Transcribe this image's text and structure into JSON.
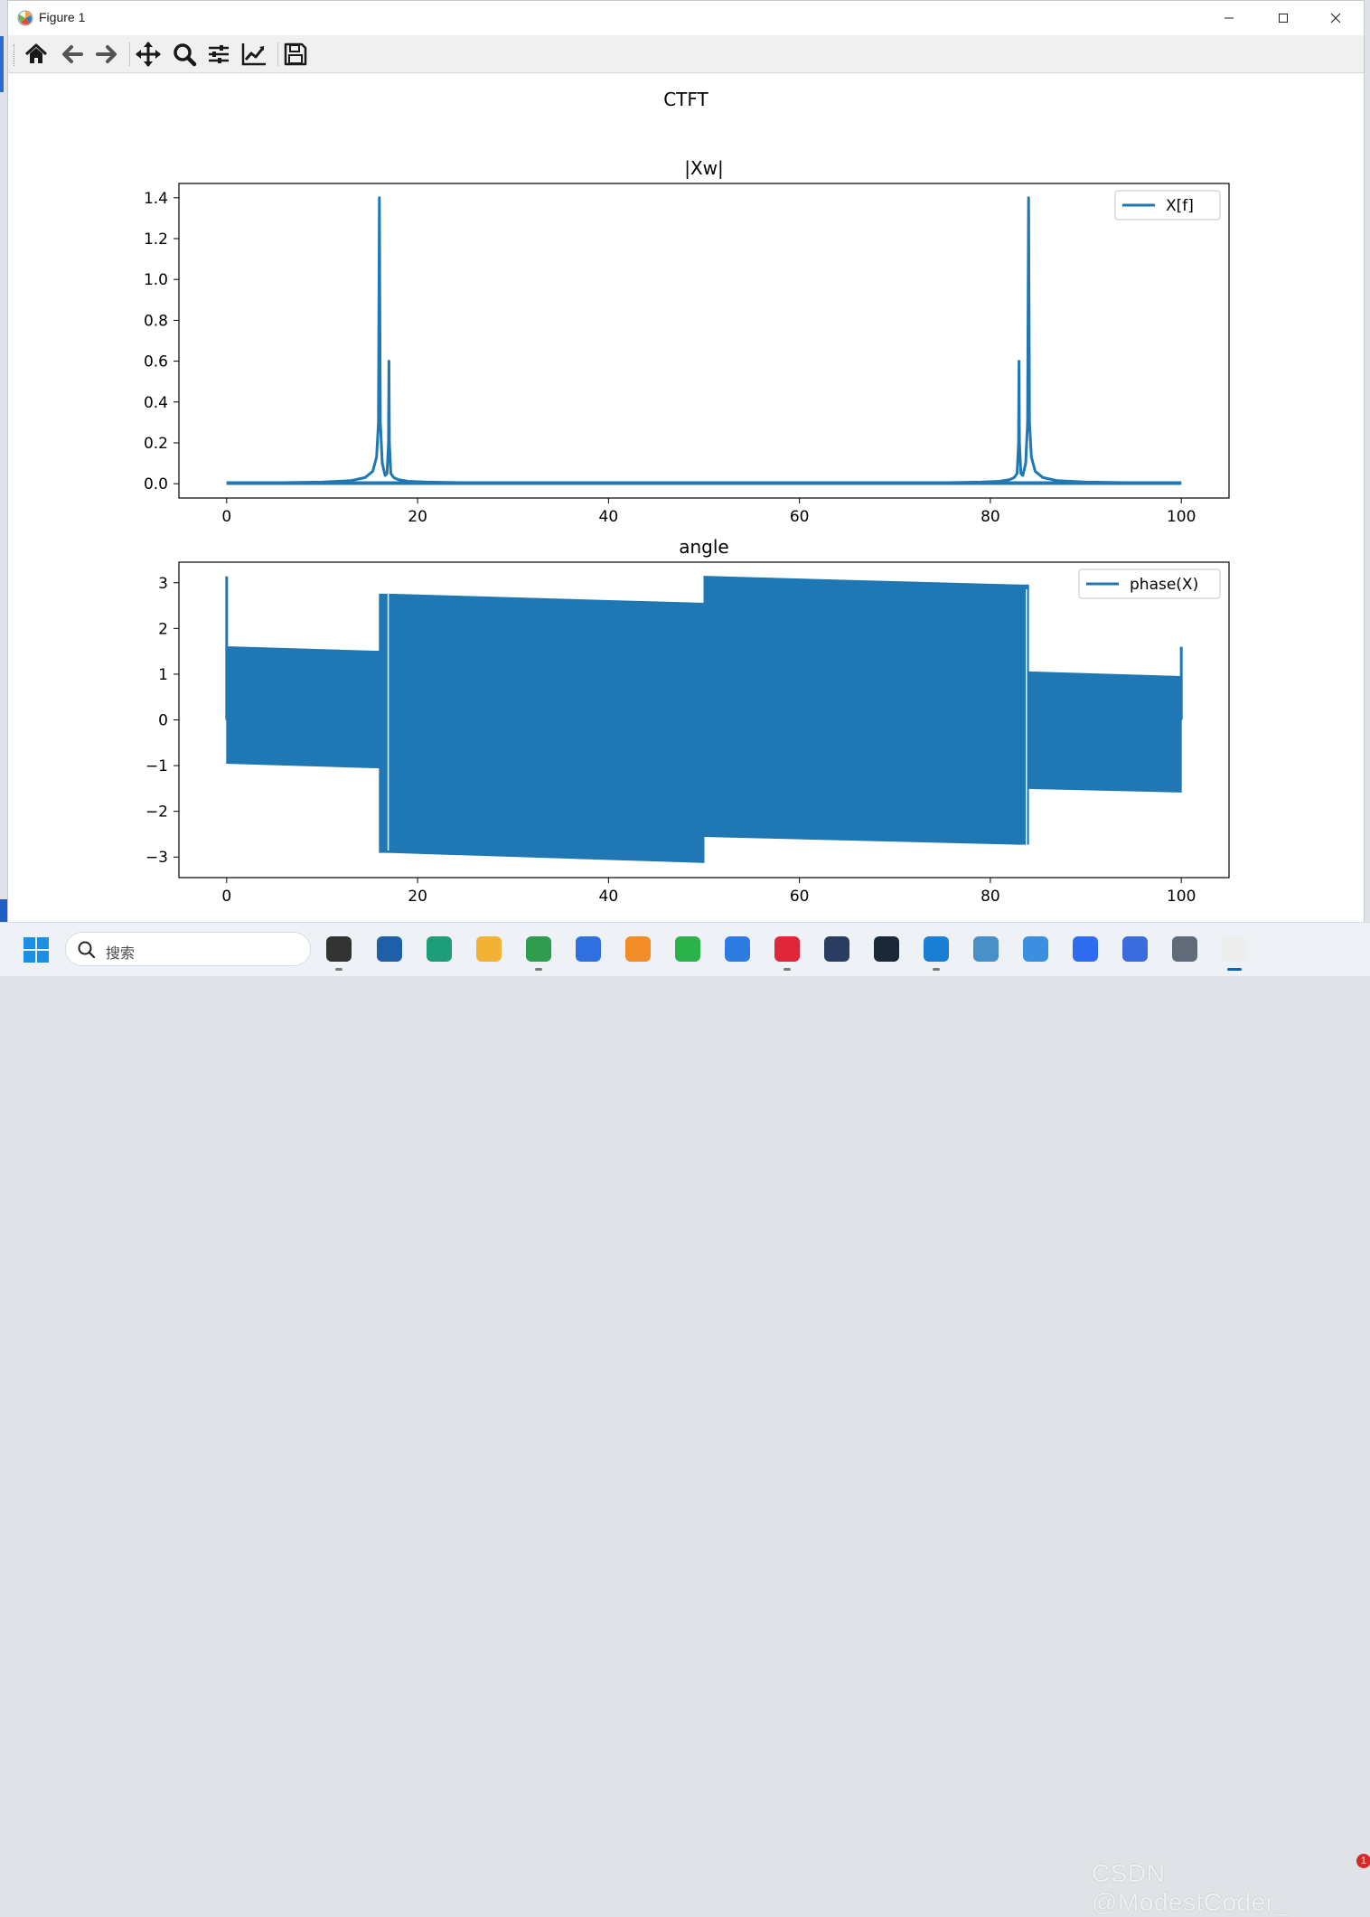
{
  "window": {
    "title": "Figure 1"
  },
  "toolbar": {
    "buttons": [
      {
        "name": "home-icon",
        "label": "Home"
      },
      {
        "name": "back-arrow-icon",
        "label": "Back"
      },
      {
        "name": "forward-arrow-icon",
        "label": "Forward"
      },
      {
        "name": "pan-icon",
        "label": "Pan"
      },
      {
        "name": "zoom-icon",
        "label": "Zoom"
      },
      {
        "name": "configure-subplots-icon",
        "label": "Subplots"
      },
      {
        "name": "edit-axis-icon",
        "label": "Customize"
      },
      {
        "name": "save-icon",
        "label": "Save"
      }
    ]
  },
  "figure": {
    "suptitle": "CTFT"
  },
  "chart_data": [
    {
      "type": "line",
      "title": "|Xw|",
      "xlabel": "",
      "ylabel": "",
      "xlim": [
        -5,
        105
      ],
      "ylim": [
        -0.07,
        1.47
      ],
      "xticks": [
        "0",
        "20",
        "40",
        "60",
        "80",
        "100"
      ],
      "yticks": [
        "0.0",
        "0.2",
        "0.4",
        "0.6",
        "0.8",
        "1.0",
        "1.2",
        "1.4"
      ],
      "legend": {
        "position": "top-right",
        "entries": [
          "X[f]"
        ]
      },
      "color": "#1f77b4",
      "series": [
        {
          "name": "X[f]",
          "x": [
            0,
            5,
            10,
            13,
            14.5,
            15.3,
            15.7,
            15.9,
            16.0,
            16.1,
            16.3,
            16.6,
            16.8,
            16.95,
            17.0,
            17.05,
            17.2,
            17.5,
            18,
            19,
            21,
            25,
            30,
            40,
            50,
            60,
            70,
            75,
            79,
            81,
            82,
            82.5,
            82.8,
            82.95,
            83.0,
            83.05,
            83.2,
            83.4,
            83.7,
            83.9,
            84.0,
            84.1,
            84.3,
            84.7,
            85.5,
            87,
            90,
            95,
            100
          ],
          "y": [
            0.003,
            0.005,
            0.008,
            0.015,
            0.03,
            0.06,
            0.13,
            0.3,
            1.4,
            0.3,
            0.1,
            0.04,
            0.05,
            0.2,
            0.6,
            0.2,
            0.05,
            0.03,
            0.02,
            0.012,
            0.008,
            0.005,
            0.004,
            0.003,
            0.003,
            0.003,
            0.004,
            0.005,
            0.008,
            0.012,
            0.02,
            0.03,
            0.05,
            0.2,
            0.6,
            0.2,
            0.05,
            0.04,
            0.1,
            0.3,
            1.4,
            0.3,
            0.13,
            0.06,
            0.03,
            0.015,
            0.008,
            0.005,
            0.003
          ]
        }
      ]
    },
    {
      "type": "area",
      "title": "angle",
      "xlabel": "",
      "ylabel": "",
      "xlim": [
        -5,
        105
      ],
      "ylim": [
        -3.45,
        3.45
      ],
      "xticks": [
        "0",
        "20",
        "40",
        "60",
        "80",
        "100"
      ],
      "yticks": [
        "3",
        "2",
        "1",
        "0",
        "−1",
        "−2",
        "−3"
      ],
      "yticks_values": [
        3,
        2,
        1,
        0,
        -1,
        -2,
        -3
      ],
      "legend": {
        "position": "top-right",
        "entries": [
          "phase(X)"
        ]
      },
      "color": "#1f77b4",
      "series": [
        {
          "name": "phase(X)",
          "description_of_envelope": "dense oscillation filling band between lower and upper envelopes",
          "segments": [
            {
              "x": [
                0,
                16
              ],
              "upper": [
                1.6,
                1.5
              ],
              "lower": [
                -0.95,
                -1.05
              ]
            },
            {
              "x": [
                16,
                17
              ],
              "upper": [
                2.75,
                2.75
              ],
              "lower": [
                -2.9,
                -2.9
              ]
            },
            {
              "x": [
                17,
                50
              ],
              "upper": [
                2.75,
                2.55
              ],
              "lower": [
                -2.9,
                -3.12
              ]
            },
            {
              "x": [
                50,
                83
              ],
              "upper": [
                3.14,
                2.95
              ],
              "lower": [
                -2.55,
                -2.72
              ]
            },
            {
              "x": [
                83,
                84
              ],
              "upper": [
                2.95,
                2.95
              ],
              "lower": [
                -2.72,
                -2.72
              ]
            },
            {
              "x": [
                84,
                100
              ],
              "upper": [
                1.05,
                0.95
              ],
              "lower": [
                -1.5,
                -1.58
              ]
            }
          ],
          "spikes": [
            {
              "x": 0,
              "y": 3.14
            },
            {
              "x": 100,
              "y": 1.6
            }
          ]
        }
      ]
    }
  ],
  "taskbar": {
    "search_placeholder": "搜索",
    "apps": [
      "terminal-app",
      "store-app",
      "edge-dev-app",
      "file-explorer-app",
      "chrome-app",
      "baidu-netdisk-app",
      "paint-app",
      "wechat-app",
      "mountain-app",
      "netease-music-app",
      "cat-app",
      "steam-app",
      "vscode-app",
      "control-panel-app",
      "notepad-app",
      "lark-app",
      "box-app",
      "calculator-app",
      "matplotlib-app"
    ],
    "watermark": "CSDN @ModestCoder_",
    "notification_count": "1"
  },
  "colors": {
    "line": "#1f77b4",
    "accent": "#0067c0"
  }
}
